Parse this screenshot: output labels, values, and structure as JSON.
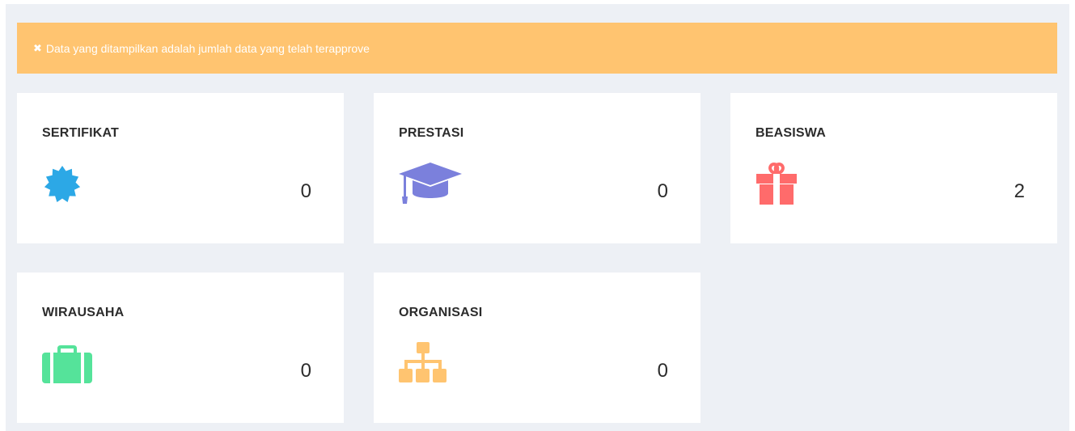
{
  "alert": {
    "icon": "close-icon",
    "text": "Data yang ditampilkan adalah jumlah data yang telah terapprove",
    "color": "#ffc470"
  },
  "cards": [
    {
      "title": "SERTIFIKAT",
      "value": "0",
      "icon": "certificate-icon",
      "icon_color": "#2ca8e6"
    },
    {
      "title": "PRESTASI",
      "value": "0",
      "icon": "graduation-cap-icon",
      "icon_color": "#7b80dc"
    },
    {
      "title": "BEASISWA",
      "value": "2",
      "icon": "gift-icon",
      "icon_color": "#ff6b6b"
    },
    {
      "title": "WIRAUSAHA",
      "value": "0",
      "icon": "briefcase-icon",
      "icon_color": "#55e39a"
    },
    {
      "title": "ORGANISASI",
      "value": "0",
      "icon": "sitemap-icon",
      "icon_color": "#ffc470"
    }
  ]
}
